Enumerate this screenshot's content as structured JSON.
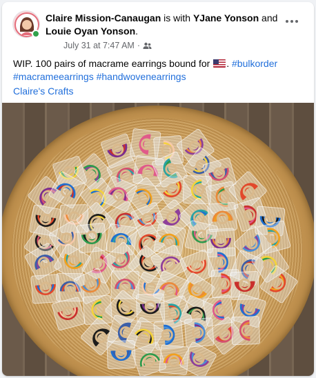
{
  "post": {
    "author": "Claire Mission-Canaugan",
    "with_text": " is with ",
    "tagged_1": "YJane Yonson",
    "and_text": " and ",
    "tagged_2": "Louie Oyan Yonson",
    "period": ".",
    "timestamp": "July 31 at 7:47 AM",
    "separator": "·",
    "audience_icon": "friends-icon",
    "text_before_flag": "WIP. 100 pairs of macrame earrings bound for ",
    "flag_icon": "us-flag-icon",
    "hashtags": [
      "#bulkorder",
      "#macrameearrings",
      "#handwovenearrings"
    ],
    "page_link": "Claire's Crafts"
  },
  "photo": {
    "earring_colors": [
      "#1f6fd1",
      "#e2482b",
      "#f2a01c",
      "#7a2e8f",
      "#2e9a4c",
      "#e05a8a",
      "#1c1c1c",
      "#f4d33b",
      "#c9302c",
      "#3b5fa8",
      "#ea8a3a",
      "#29a3a3",
      "#8e3f9a",
      "#d4506e",
      "#f7c9a8",
      "#4b8fd6"
    ]
  }
}
